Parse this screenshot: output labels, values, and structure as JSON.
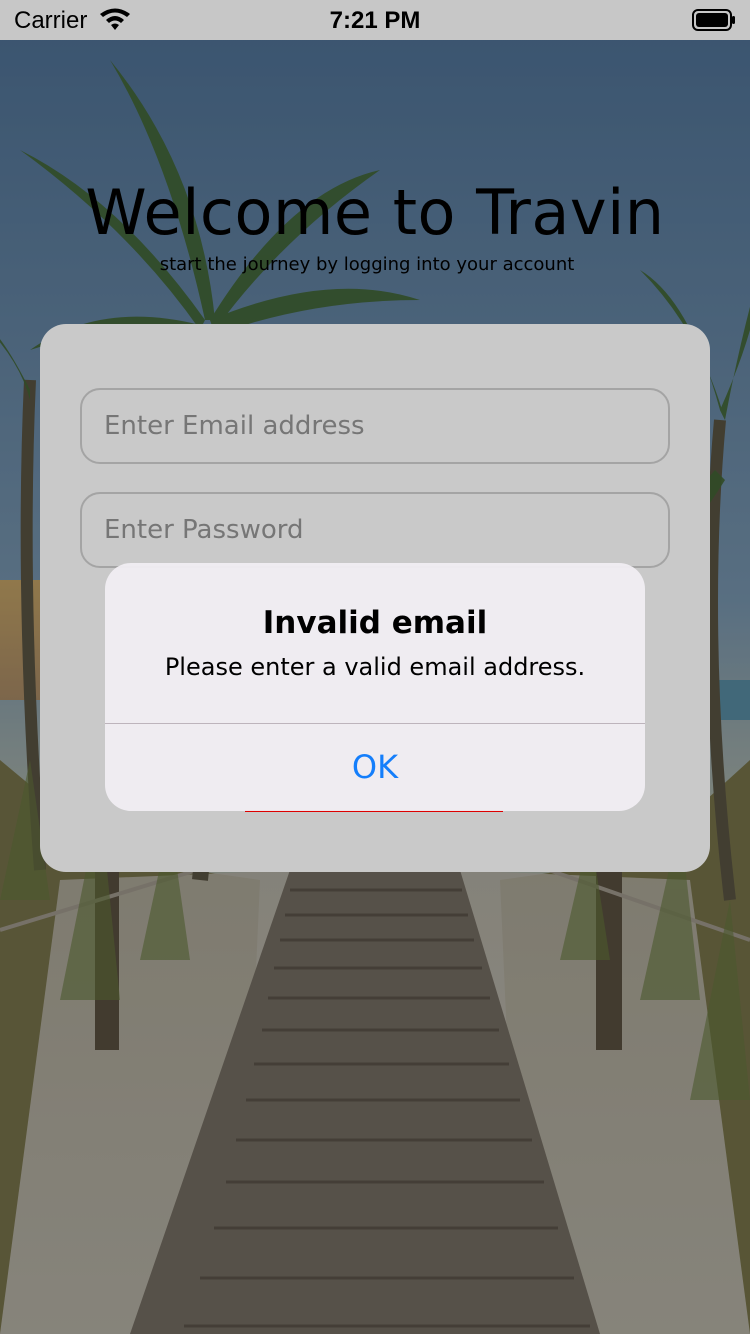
{
  "status_bar": {
    "carrier": "Carrier",
    "time": "7:21 PM",
    "wifi_icon": "wifi-icon",
    "battery_icon": "battery-icon"
  },
  "header": {
    "title": "Welcome to Travin",
    "subtitle": "start the journey by logging into your account"
  },
  "login_form": {
    "email": {
      "value": "",
      "placeholder": "Enter Email address"
    },
    "password": {
      "value": "",
      "placeholder": "Enter Password"
    }
  },
  "alert": {
    "title": "Invalid email",
    "message": "Please enter a valid email address.",
    "ok_label": "OK"
  },
  "colors": {
    "alert_button": "#147efb",
    "link": "#dd0000",
    "card": "#c9c9c9"
  }
}
